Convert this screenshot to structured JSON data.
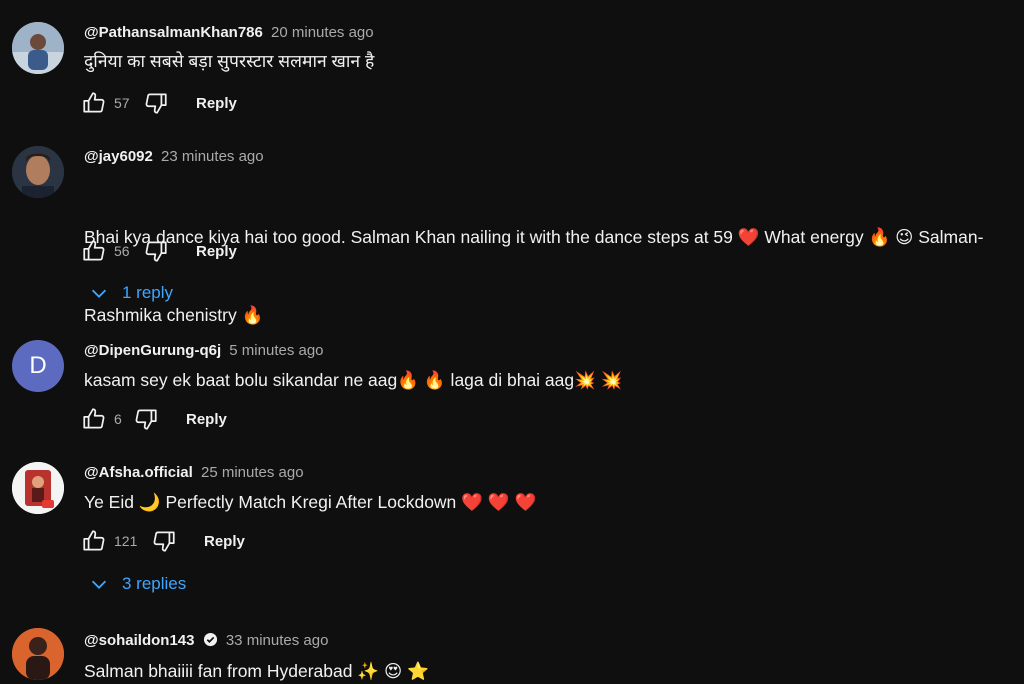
{
  "colors": {
    "background": "#0f0f0f",
    "text": "#f1f1f1",
    "muted": "#aaaaaa",
    "link": "#3ea6ff",
    "avatar_d": "#5c6bc0"
  },
  "comments": [
    {
      "handle": "@PathansalmanKhan786",
      "time": "20 minutes ago",
      "text": "दुनिया का सबसे बड़ा सुपरस्टार सलमान खान है",
      "likes": "57",
      "reply_label": "Reply"
    },
    {
      "handle": "@jay6092",
      "time": "23 minutes ago",
      "text_line1": "Bhai kya dance kiya hai too good. Salman Khan nailing it with the dance steps at 59 ❤️ What energy 🔥 😉 Salman-",
      "text_line2": "Rashmika chenistry 🔥",
      "likes": "56",
      "reply_label": "Reply",
      "replies_label": "1 reply"
    },
    {
      "handle": "@DipenGurung-q6j",
      "time": "5 minutes ago",
      "avatar_letter": "D",
      "text": "kasam sey ek baat bolu sikandar ne aag🔥 🔥 laga di bhai aag💥 💥",
      "likes": "6",
      "reply_label": "Reply"
    },
    {
      "handle": "@Afsha.official",
      "time": "25 minutes ago",
      "text": "Ye Eid 🌙 Perfectly Match Kregi After Lockdown ❤️ ❤️ ❤️",
      "likes": "121",
      "reply_label": "Reply",
      "replies_label": "3 replies"
    },
    {
      "handle": "@sohaildon143",
      "time": "33 minutes ago",
      "text": "Salman bhaiiii fan from Hyderabad ✨ 😍 ⭐"
    }
  ]
}
